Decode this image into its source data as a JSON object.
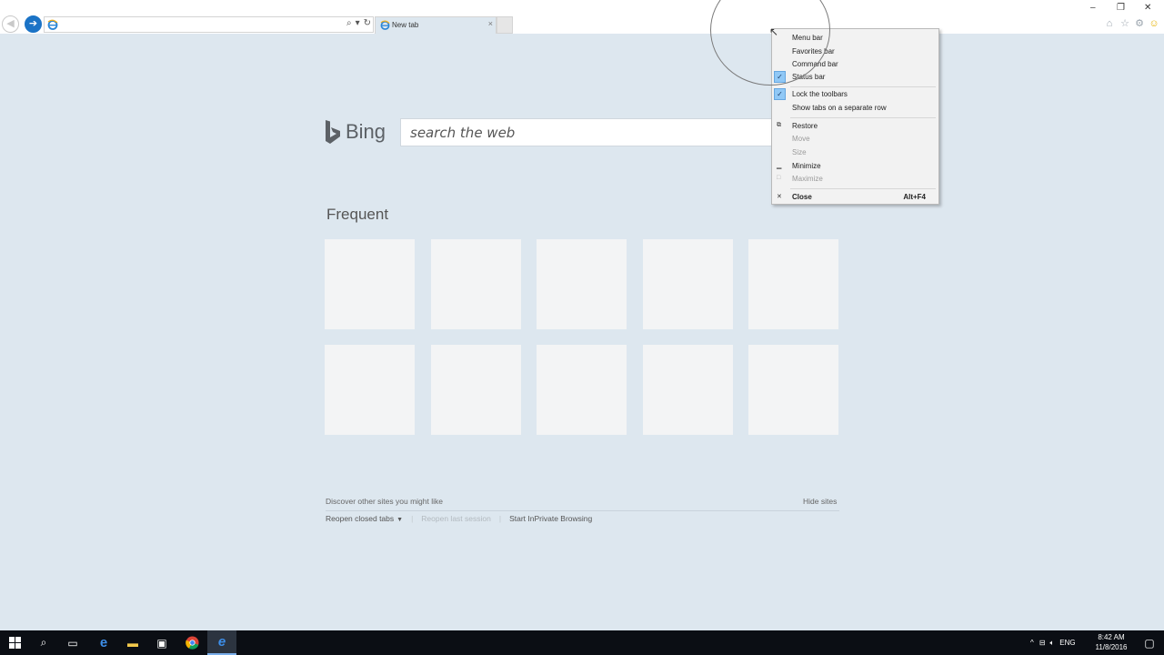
{
  "tab": {
    "label": "New tab",
    "close": "×"
  },
  "window_controls": {
    "minimize": "–",
    "restore": "❐",
    "close": "✕"
  },
  "toolbar_icons": [
    "home-icon",
    "favorites-star-icon",
    "tools-gear-icon",
    "smiley-feedback-icon"
  ],
  "bing": {
    "logo_text": "Bing",
    "search_placeholder": "search the web"
  },
  "frequent": {
    "title": "Frequent",
    "tile_count": 10
  },
  "footer": {
    "discover": "Discover other sites you might like",
    "hide_sites": "Hide sites",
    "reopen_closed_tabs": "Reopen closed tabs",
    "reopen_last_session": "Reopen last session",
    "start_inprivate": "Start InPrivate Browsing"
  },
  "context_menu": {
    "menu_bar": "Menu bar",
    "favorites_bar": "Favorites bar",
    "command_bar": "Command bar",
    "status_bar": "Status bar",
    "lock_toolbars": "Lock the toolbars",
    "show_tabs_separate": "Show tabs on a separate row",
    "restore": "Restore",
    "move": "Move",
    "size": "Size",
    "minimize": "Minimize",
    "maximize": "Maximize",
    "close": "Close",
    "close_shortcut": "Alt+F4",
    "checked_items": [
      "Status bar",
      "Lock the toolbars"
    ]
  },
  "taskbar": {
    "apps": [
      "start-icon",
      "search-icon",
      "task-view-icon",
      "edge-icon",
      "file-explorer-icon",
      "store-icon",
      "chrome-icon",
      "internet-explorer-icon"
    ],
    "language": "ENG",
    "time": "8:42 AM",
    "date": "11/8/2016"
  },
  "colors": {
    "page_bg": "#dde7ef",
    "accent": "#1b73c6",
    "checkbox_bg": "#90c8f6",
    "taskbar_bg": "#0b0e14"
  }
}
